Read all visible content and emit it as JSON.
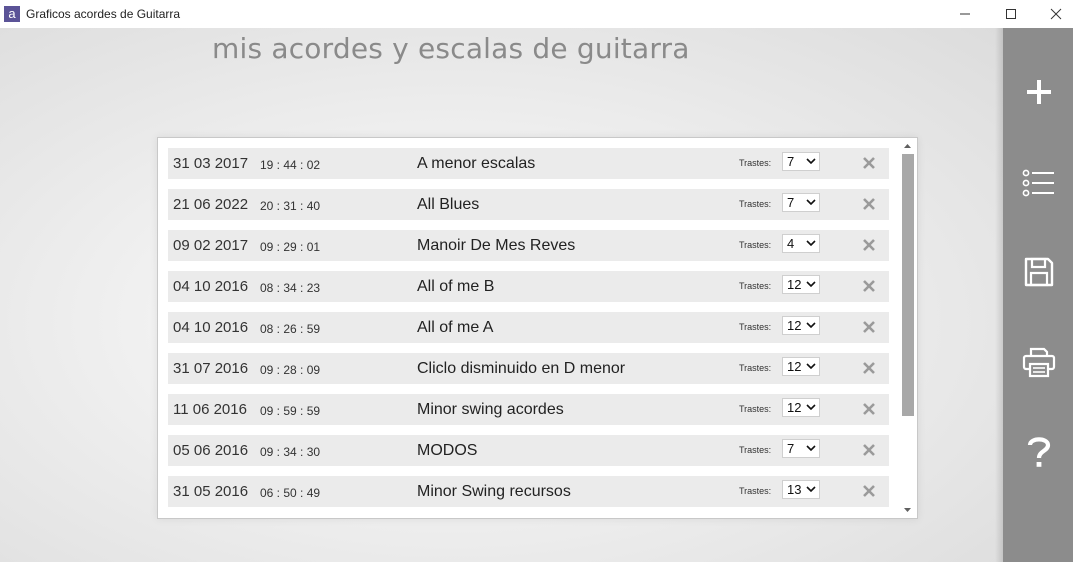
{
  "window": {
    "icon_letter": "a",
    "title": "Graficos acordes de Guitarra",
    "minimize": "—",
    "maximize": "☐",
    "close": "✕"
  },
  "page": {
    "title": "mis acordes y escalas de guitarra"
  },
  "list": {
    "frets_label": "Trastes:",
    "items": [
      {
        "date": "31 03 2017",
        "time": "19 : 44 : 02",
        "name": "A menor escalas",
        "frets": "7"
      },
      {
        "date": "21 06 2022",
        "time": "20 : 31 : 40",
        "name": "All Blues",
        "frets": "7"
      },
      {
        "date": "09 02 2017",
        "time": "09 : 29 : 01",
        "name": "Manoir De Mes Reves",
        "frets": "4"
      },
      {
        "date": "04 10 2016",
        "time": "08 : 34 : 23",
        "name": "All of me B",
        "frets": "12"
      },
      {
        "date": "04 10 2016",
        "time": "08 : 26 : 59",
        "name": "All of me A",
        "frets": "12"
      },
      {
        "date": "31 07 2016",
        "time": "09 : 28 : 09",
        "name": "Cliclo disminuido en D menor",
        "frets": "12"
      },
      {
        "date": "11 06 2016",
        "time": "09 : 59 : 59",
        "name": "Minor swing acordes",
        "frets": "12"
      },
      {
        "date": "05 06 2016",
        "time": "09 : 34 : 30",
        "name": "MODOS",
        "frets": "7"
      },
      {
        "date": "31 05 2016",
        "time": "06 : 50 : 49",
        "name": "Minor Swing recursos",
        "frets": "13"
      }
    ]
  },
  "toolbar": {
    "icons": [
      "plus-icon",
      "list-icon",
      "save-icon",
      "print-icon",
      "help-icon"
    ]
  },
  "colors": {
    "sidebar": "#8c8c8c",
    "title_text": "#8a8a8a",
    "row_bg": "#ebebeb",
    "app_icon": "#5b5397"
  }
}
